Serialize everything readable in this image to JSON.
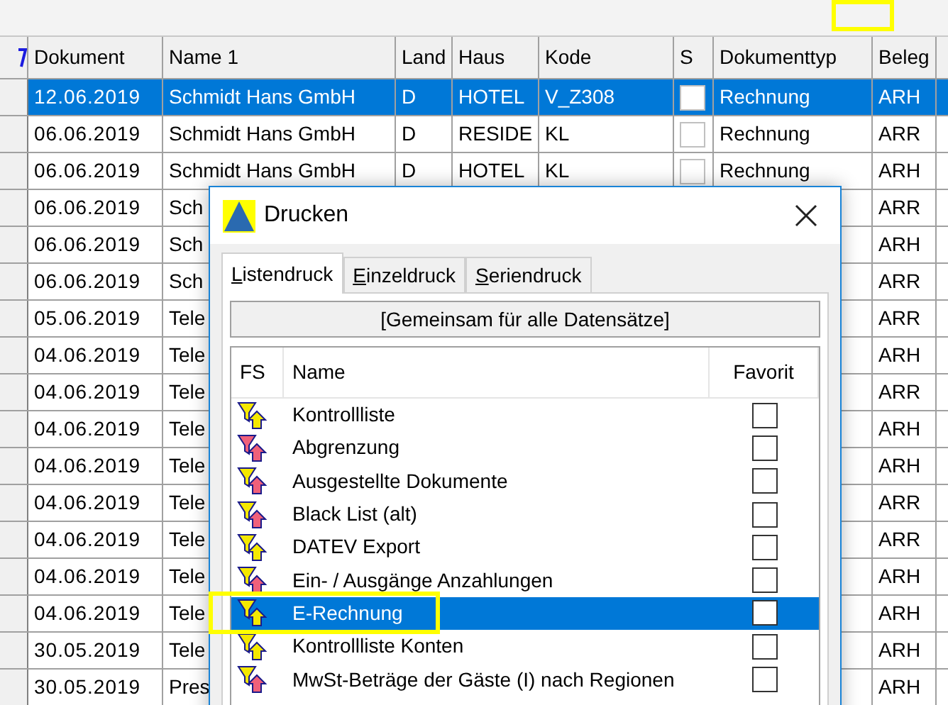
{
  "table": {
    "columns": [
      "Dokument",
      "Name 1",
      "Land",
      "Haus",
      "Kode",
      "S",
      "Dokumenttyp",
      "Beleg"
    ],
    "rows": [
      {
        "selected": true,
        "cells": [
          "12.06.2019",
          "Schmidt Hans GmbH",
          "D",
          "HOTEL",
          "V_Z308",
          "",
          "Rechnung",
          "ARH"
        ],
        "checked": false
      },
      {
        "selected": false,
        "cells": [
          "06.06.2019",
          "Schmidt Hans GmbH",
          "D",
          "RESIDE",
          "KL",
          "",
          "Rechnung",
          "ARR"
        ],
        "checked": false
      },
      {
        "selected": false,
        "cells": [
          "06.06.2019",
          "Schmidt Hans GmbH",
          "D",
          "HOTEL",
          "KL",
          "",
          "Rechnung",
          "ARH"
        ],
        "checked": false
      },
      {
        "selected": false,
        "cells": [
          "06.06.2019",
          "Sch",
          "",
          "",
          "",
          "",
          "",
          "ARR"
        ]
      },
      {
        "selected": false,
        "cells": [
          "06.06.2019",
          "Sch",
          "",
          "",
          "",
          "",
          "",
          "ARH"
        ]
      },
      {
        "selected": false,
        "cells": [
          "06.06.2019",
          "Sch",
          "",
          "",
          "",
          "",
          "",
          "ARR"
        ]
      },
      {
        "selected": false,
        "cells": [
          "05.06.2019",
          "Tele",
          "",
          "",
          "",
          "",
          "",
          "ARR"
        ]
      },
      {
        "selected": false,
        "cells": [
          "04.06.2019",
          "Tele",
          "",
          "",
          "",
          "",
          "",
          "ARH"
        ]
      },
      {
        "selected": false,
        "cells": [
          "04.06.2019",
          "Tele",
          "",
          "",
          "",
          "",
          "",
          "ARR"
        ]
      },
      {
        "selected": false,
        "cells": [
          "04.06.2019",
          "Tele",
          "",
          "",
          "",
          "",
          "",
          "ARH"
        ]
      },
      {
        "selected": false,
        "cells": [
          "04.06.2019",
          "Tele",
          "",
          "",
          "",
          "",
          "",
          "ARH"
        ]
      },
      {
        "selected": false,
        "cells": [
          "04.06.2019",
          "Tele",
          "",
          "",
          "",
          "",
          "",
          "ARR"
        ]
      },
      {
        "selected": false,
        "cells": [
          "04.06.2019",
          "Tele",
          "",
          "",
          "",
          "",
          "",
          "ARR"
        ]
      },
      {
        "selected": false,
        "cells": [
          "04.06.2019",
          "Tele",
          "",
          "",
          "",
          "",
          "",
          "ARH"
        ]
      },
      {
        "selected": false,
        "cells": [
          "04.06.2019",
          "Tele",
          "",
          "",
          "",
          "",
          "",
          "ARH"
        ]
      },
      {
        "selected": false,
        "cells": [
          "30.05.2019",
          "Tele",
          "",
          "",
          "",
          "",
          "",
          "ARH"
        ]
      },
      {
        "selected": false,
        "cells": [
          "30.05.2019",
          "Pres",
          "",
          "",
          "",
          "",
          "",
          "ARH"
        ]
      }
    ]
  },
  "dialog": {
    "title": "Drucken",
    "tabs": [
      {
        "label": "Listendruck",
        "selected": true
      },
      {
        "label": "Einzeldruck",
        "selected": false
      },
      {
        "label": "Seriendruck",
        "selected": false
      }
    ],
    "group": "[Gemeinsam für alle Datensätze]",
    "columns": [
      "FS",
      "Name",
      "Favorit"
    ],
    "items": [
      {
        "name": "Kontrollliste",
        "kind": "yellow",
        "favorite": false,
        "selected": false
      },
      {
        "name": "Abgrenzung",
        "kind": "red",
        "favorite": false,
        "selected": false
      },
      {
        "name": "Ausgestellte Dokumente",
        "kind": "mixed",
        "favorite": false,
        "selected": false
      },
      {
        "name": "Black List (alt)",
        "kind": "mixed",
        "favorite": false,
        "selected": false
      },
      {
        "name": "DATEV Export",
        "kind": "yellow",
        "favorite": false,
        "selected": false
      },
      {
        "name": "Ein- / Ausgänge Anzahlungen",
        "kind": "mixed",
        "favorite": false,
        "selected": false
      },
      {
        "name": "E-Rechnung",
        "kind": "yellow",
        "favorite": false,
        "selected": true
      },
      {
        "name": "Kontrollliste Konten",
        "kind": "yellow",
        "favorite": false,
        "selected": false
      },
      {
        "name": "MwSt-Beträge der Gäste (I) nach Regionen",
        "kind": "mixed",
        "favorite": false,
        "selected": false
      }
    ]
  }
}
